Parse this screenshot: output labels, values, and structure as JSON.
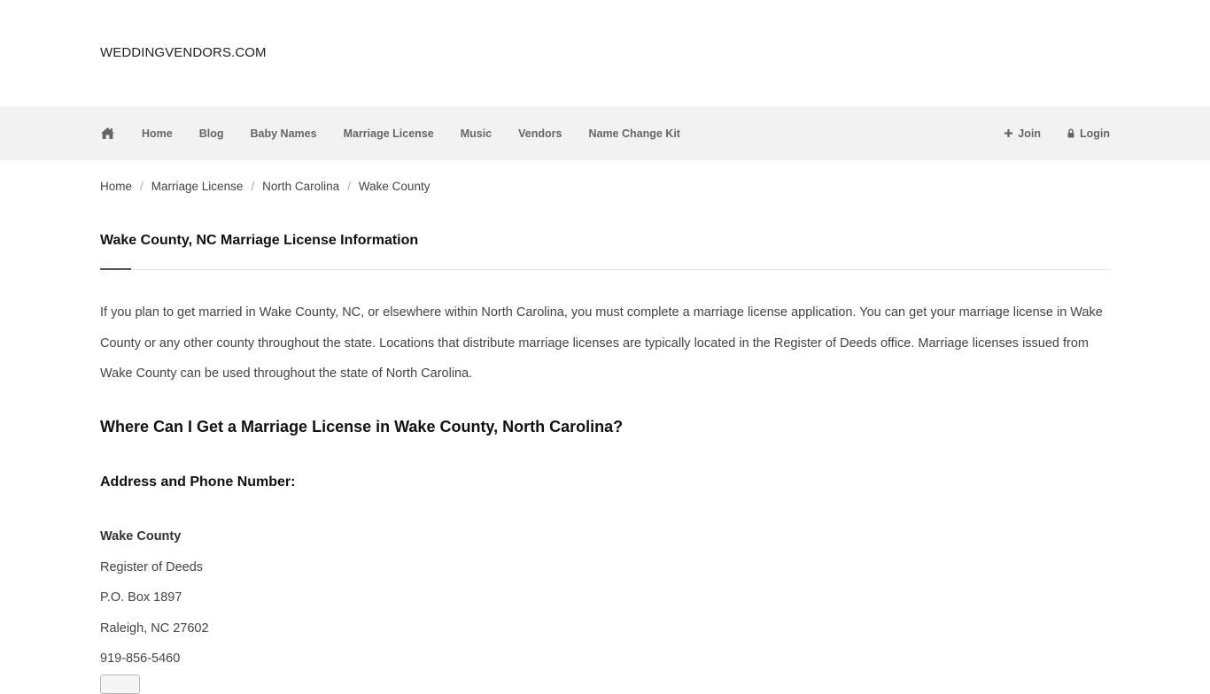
{
  "site": {
    "logo": "WEDDINGVENDORS.COM"
  },
  "nav": {
    "icon": "home-icon",
    "items": [
      {
        "label": "Home"
      },
      {
        "label": "Blog"
      },
      {
        "label": "Baby Names"
      },
      {
        "label": "Marriage License"
      },
      {
        "label": "Music"
      },
      {
        "label": "Vendors"
      },
      {
        "label": "Name Change Kit"
      }
    ],
    "join": {
      "label": "Join",
      "icon": "plus-icon"
    },
    "login": {
      "label": "Login",
      "icon": "lock-icon"
    }
  },
  "breadcrumb": [
    "Home",
    "Marriage License",
    "North Carolina",
    "Wake County"
  ],
  "page": {
    "title": "Wake County, NC Marriage License Information",
    "intro": "If you plan to get married in Wake County, NC, or elsewhere within North Carolina, you must complete a marriage license application. You can get your marriage license in Wake County or any other county throughout the state. Locations that distribute marriage licenses are typically located in the Register of Deeds office. Marriage licenses issued from Wake County can be used throughout the state of North Carolina.",
    "where_heading": "Where Can I Get a Marriage License in Wake County, North Carolina?",
    "address_heading": "Address and Phone Number:"
  },
  "address": {
    "county": "Wake County",
    "office": "Register of Deeds",
    "po_box": "P.O. Box 1897",
    "city": "Raleigh, NC 27602",
    "phone": "919-856-5460"
  }
}
